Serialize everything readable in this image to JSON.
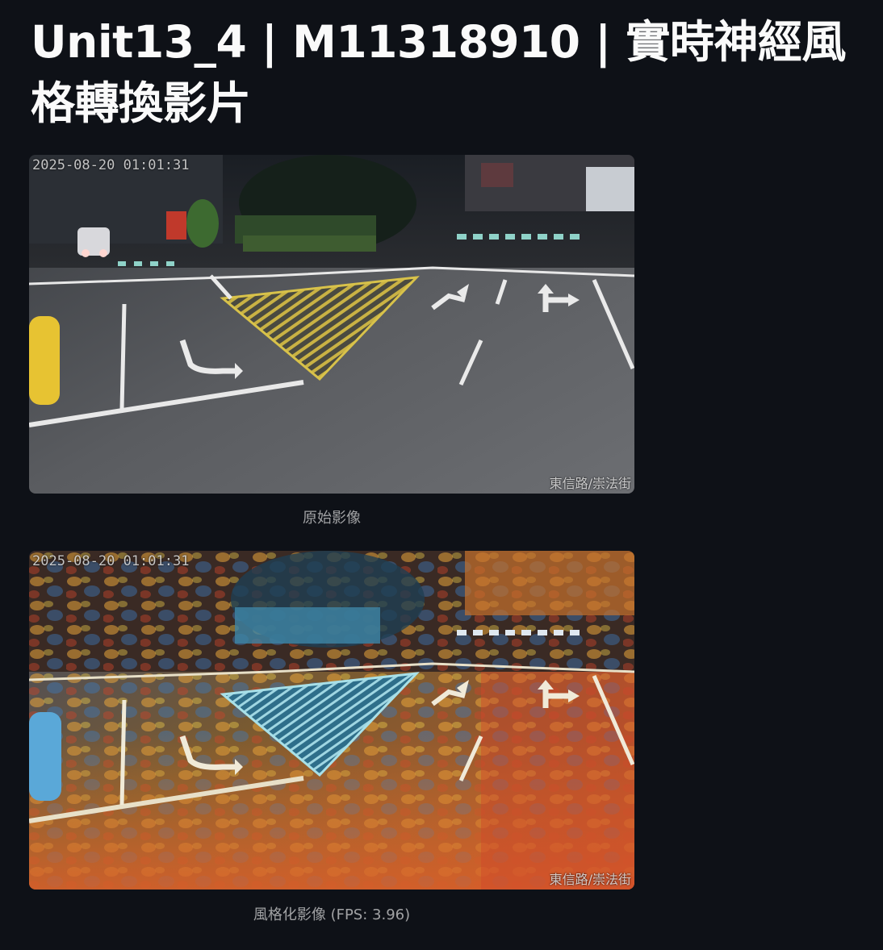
{
  "page": {
    "title": "Unit13_4 | M11318910 | 實時神經風格轉換影片"
  },
  "original_frame": {
    "timestamp_overlay": "2025-08-20 01:01:31",
    "location_overlay": "東信路/崇法街",
    "caption": "原始影像"
  },
  "stylized_frame": {
    "timestamp_overlay": "2025-08-20 01:01:31",
    "location_overlay": "東信路/崇法街",
    "caption": "風格化影像 (FPS: 3.96)"
  },
  "colors": {
    "background": "#0e1117",
    "title_text": "#fafafa",
    "caption_text": "#9a9ca3"
  }
}
